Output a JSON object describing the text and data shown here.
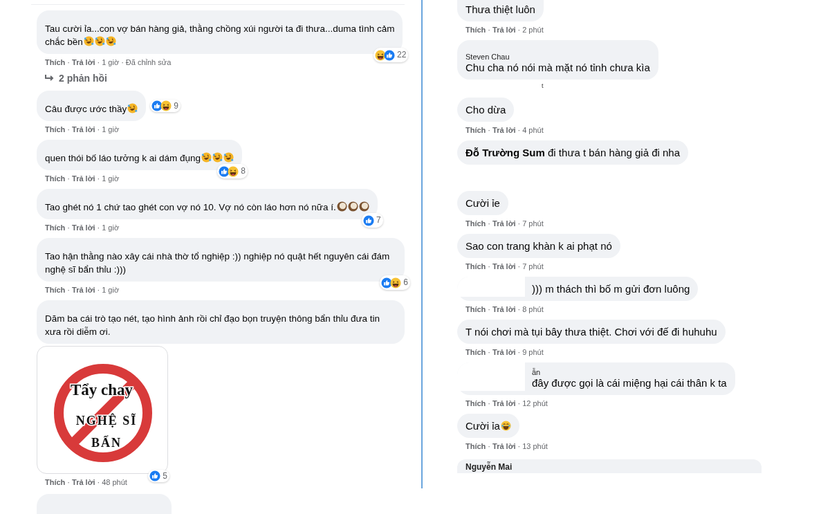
{
  "separator": "·",
  "columns": [
    {
      "comments": [
        {
          "lines": [
            "Tau cười ỉa...con vợ bán hàng giả, thằng chồng xúi người ta đi thưa...duma tình cảm",
            "chắc bền"
          ],
          "emojis": [
            {
              "kind": "rofl"
            },
            {
              "kind": "rofl"
            },
            {
              "kind": "rofl"
            }
          ],
          "reactions": {
            "kind": "corner",
            "icons": [
              {
                "kind": "haha"
              },
              {
                "kind": "like"
              }
            ],
            "count": "22"
          },
          "actions": [
            "Thích",
            "Trả lời"
          ],
          "time": "1 giờ",
          "edited": "Đã chỉnh sửa",
          "replies": "2 phản hồi"
        },
        {
          "text": "Câu được ước thầy",
          "emojis": [
            {
              "kind": "rofl"
            }
          ],
          "reactions": {
            "kind": "inline",
            "icons": [
              {
                "kind": "like"
              },
              {
                "kind": "haha"
              }
            ],
            "count": "9"
          },
          "actions": [
            "Thích",
            "Trả lời"
          ],
          "time": "1 giờ"
        },
        {
          "text": "quen thói bố láo tưởng k ai dám đụng",
          "emojis": [
            {
              "kind": "rofl"
            },
            {
              "kind": "rofl"
            },
            {
              "kind": "rofl"
            }
          ],
          "reactions": {
            "kind": "corner",
            "icons": [
              {
                "kind": "like"
              },
              {
                "kind": "haha"
              }
            ],
            "count": "8"
          },
          "actions": [
            "Thích",
            "Trả lời"
          ],
          "time": "1 giờ"
        },
        {
          "text": "Tao ghét nó 1 chứ tao ghét con vợ nó 10. Vợ nó còn láo hơn nó nữa í.",
          "emojis": [
            {
              "kind": "coconut"
            },
            {
              "kind": "coconut"
            },
            {
              "kind": "coconut"
            }
          ],
          "reactions": {
            "kind": "corner",
            "icons": [
              {
                "kind": "like"
              }
            ],
            "count": "7"
          },
          "actions": [
            "Thích",
            "Trả lời"
          ],
          "time": "1 giờ"
        },
        {
          "text": "Tao hận thằng nào xây cái nhà thờ tổ nghiệp :)) nghiệp nó quật hết nguyên cái đám nghệ sĩ bẩn thỉu :)))",
          "reactions": {
            "kind": "corner",
            "icons": [
              {
                "kind": "like"
              },
              {
                "kind": "haha"
              }
            ],
            "count": "6"
          },
          "actions": [
            "Thích",
            "Trả lời"
          ],
          "time": "1 giờ"
        },
        {
          "text": "Dăm ba cái trò tạo nét, tạo hình ảnh rồi chỉ đạo bọn truyện thông bẩn thỉu đưa tin xưa rồi diễm ơi.",
          "image": {
            "lines": [
              "Tẩy chay",
              "NGHỆ SĨ",
              "BẨN"
            ]
          },
          "reactions": {
            "kind": "image",
            "icons": [
              {
                "kind": "like"
              }
            ],
            "count": "5"
          },
          "actions": [
            "Thích",
            "Trả lời"
          ],
          "time": "48 phút"
        },
        {
          "partial": true
        }
      ]
    },
    {
      "comments": [
        {
          "text": "Thưa thiệt luôn",
          "actions": [
            "Thích",
            "Trả lời"
          ],
          "time": "2 phút"
        },
        {
          "author": "Steven Chau",
          "text": "Chu cha nó nói mà mặt nó tỉnh chưa kìa",
          "stray": "t"
        },
        {
          "text": "Cho dừa",
          "actions": [
            "Thích",
            "Trả lời"
          ],
          "time": "4 phút"
        },
        {
          "text": "**Đỗ Trường Sum** đi thưa t bán hàng giả đi nha"
        },
        {
          "text": "Cười ỉe",
          "actions": [
            "Thích",
            "Trả lời"
          ],
          "time": "7 phút"
        },
        {
          "text": "Sao con trang khàn k ai phạt nó",
          "actions": [
            "Thích",
            "Trả lời"
          ],
          "time": "7 phút"
        },
        {
          "text": "))) m thách thì bố m gửi đơn luông",
          "redacted": true,
          "actions": [
            "Thích",
            "Trả lời"
          ],
          "time": "8 phút"
        },
        {
          "text": "T nói chơi mà tụi bây thưa thiệt. Chơi với đế đi huhuhu",
          "actions": [
            "Thích",
            "Trả lời"
          ],
          "time": "9 phút"
        },
        {
          "author": "ẫn",
          "text": "đây được gọi là cái miệng hại cái thân k ta",
          "redacted": true,
          "actions": [
            "Thích",
            "Trả lời"
          ],
          "time": "12 phút"
        },
        {
          "text": "Cười ỉa",
          "emojis": [
            {
              "kind": "grin"
            }
          ],
          "actions": [
            "Thích",
            "Trả lời"
          ],
          "time": "13 phút"
        },
        {
          "author": "Nguyễn Mai",
          "partial": true
        }
      ]
    }
  ]
}
